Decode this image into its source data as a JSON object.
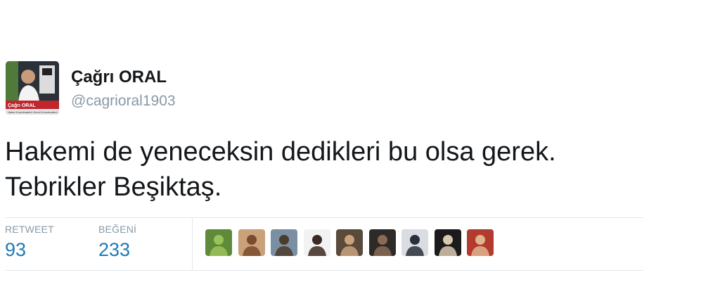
{
  "user": {
    "display_name": "Çağrı ORAL",
    "handle": "@cagrioral1903",
    "avatar_caption": "Çağrı ORAL",
    "avatar_subcaption": "Haber Koordinatörü Genel Koordinatörü"
  },
  "tweet": {
    "text_line1": "Hakemi de yeneceksin dedikleri bu olsa gerek.",
    "text_line2": "Tebrikler Beşiktaş."
  },
  "stats": {
    "retweet_label": "RETWEET",
    "retweet_count": "93",
    "like_label": "BEĞENİ",
    "like_count": "233"
  },
  "likers": [
    {
      "icon": "liker-avatar",
      "colors": [
        "#5f8a3a",
        "#9cc25a"
      ]
    },
    {
      "icon": "liker-avatar",
      "colors": [
        "#c9a27a",
        "#7a4a2e"
      ]
    },
    {
      "icon": "liker-avatar",
      "colors": [
        "#7b8fa3",
        "#4a3b2c"
      ]
    },
    {
      "icon": "liker-avatar",
      "colors": [
        "#f2f2f2",
        "#3b2a22"
      ]
    },
    {
      "icon": "liker-avatar",
      "colors": [
        "#5a4a3a",
        "#caa27e"
      ]
    },
    {
      "icon": "liker-avatar",
      "colors": [
        "#2e2a28",
        "#8a6a55"
      ]
    },
    {
      "icon": "liker-avatar",
      "colors": [
        "#d9dde2",
        "#2a2f3a"
      ]
    },
    {
      "icon": "liker-avatar",
      "colors": [
        "#1b1b1b",
        "#d8c8b0"
      ]
    },
    {
      "icon": "liker-avatar",
      "colors": [
        "#b33a2e",
        "#e0b48c"
      ]
    }
  ],
  "colors": {
    "name": "#14171a",
    "handle": "#8899a6",
    "count": "#1f7ab5",
    "divider": "#e1e8ed"
  }
}
